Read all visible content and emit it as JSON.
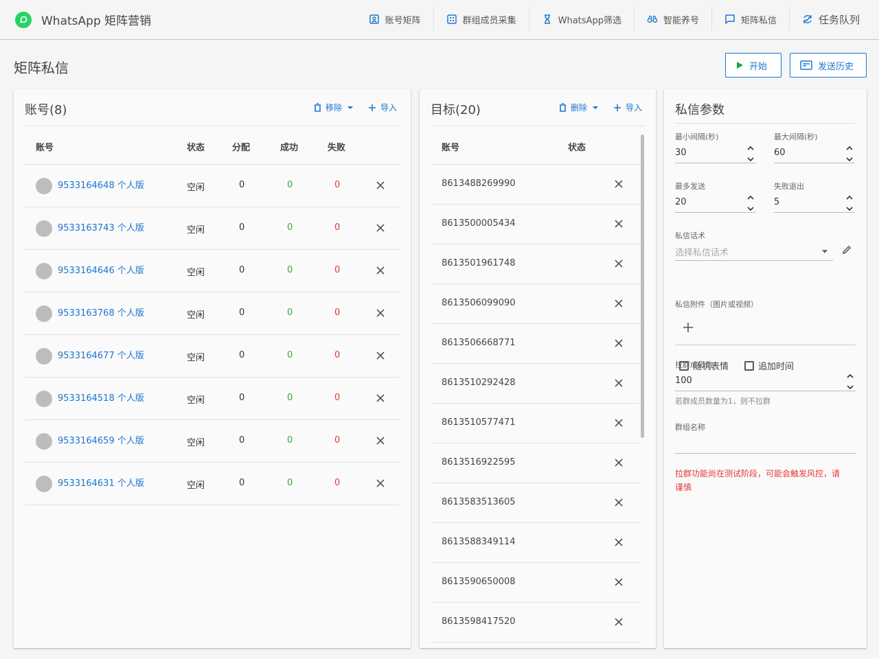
{
  "app": {
    "title": "WhatsApp 矩阵营销",
    "brand_color": "#25d366",
    "accent": "#1976d2"
  },
  "nav": [
    {
      "label": "账号矩阵",
      "icon": "account-box-icon"
    },
    {
      "label": "群组成员采集",
      "icon": "grid-icon"
    },
    {
      "label": "WhatsApp筛选",
      "icon": "hourglass-icon"
    },
    {
      "label": "智能养号",
      "icon": "binoculars-icon"
    },
    {
      "label": "矩阵私信",
      "icon": "message-icon"
    },
    {
      "label": "任务队列",
      "icon": "sync-icon"
    }
  ],
  "page": {
    "title": "矩阵私信",
    "start_label": "开始",
    "history_label": "发送历史"
  },
  "accounts": {
    "title": "账号(8)",
    "remove_label": "移除",
    "import_label": "导入",
    "columns": [
      "账号",
      "状态",
      "分配",
      "成功",
      "失败"
    ],
    "rows": [
      {
        "account": "9533164648 个人版",
        "status": "空闲",
        "assigned": "0",
        "success": "0",
        "fail": "0"
      },
      {
        "account": "9533163743 个人版",
        "status": "空闲",
        "assigned": "0",
        "success": "0",
        "fail": "0"
      },
      {
        "account": "9533164646 个人版",
        "status": "空闲",
        "assigned": "0",
        "success": "0",
        "fail": "0"
      },
      {
        "account": "9533163768 个人版",
        "status": "空闲",
        "assigned": "0",
        "success": "0",
        "fail": "0"
      },
      {
        "account": "9533164677 个人版",
        "status": "空闲",
        "assigned": "0",
        "success": "0",
        "fail": "0"
      },
      {
        "account": "9533164518 个人版",
        "status": "空闲",
        "assigned": "0",
        "success": "0",
        "fail": "0"
      },
      {
        "account": "9533164659 个人版",
        "status": "空闲",
        "assigned": "0",
        "success": "0",
        "fail": "0"
      },
      {
        "account": "9533164631 个人版",
        "status": "空闲",
        "assigned": "0",
        "success": "0",
        "fail": "0"
      }
    ]
  },
  "targets": {
    "title": "目标(20)",
    "delete_label": "删除",
    "import_label": "导入",
    "columns": [
      "账号",
      "状态"
    ],
    "rows": [
      "8613488269990",
      "8613500005434",
      "8613501961748",
      "8613506099090",
      "8613506668771",
      "8613510292428",
      "8613510577471",
      "8613516922595",
      "8613583513605",
      "8613588349114",
      "8613590650008",
      "8613598417520"
    ]
  },
  "params": {
    "title": "私信参数",
    "min_interval_label": "最小间隔(秒)",
    "min_interval": "30",
    "max_interval_label": "最大间隔(秒)",
    "max_interval": "60",
    "max_send_label": "最多发送",
    "max_send": "20",
    "fail_exit_label": "失败退出",
    "fail_exit": "5",
    "script_label": "私信话术",
    "script_placeholder": "选择私信话术",
    "random_emoji_label": "随机表情",
    "append_time_label": "追加时间",
    "attachment_label": "私信附件（图片或视频）",
    "group_members_label": "拉群成员数",
    "group_members": "100",
    "group_members_hint": "若群成员数量为1，则不拉群",
    "group_name_label": "群组名称",
    "warning": "拉群功能尚在测试阶段，可能会触发风控，请谨慎",
    "success_color": "#43a047",
    "fail_color": "#e53935"
  }
}
